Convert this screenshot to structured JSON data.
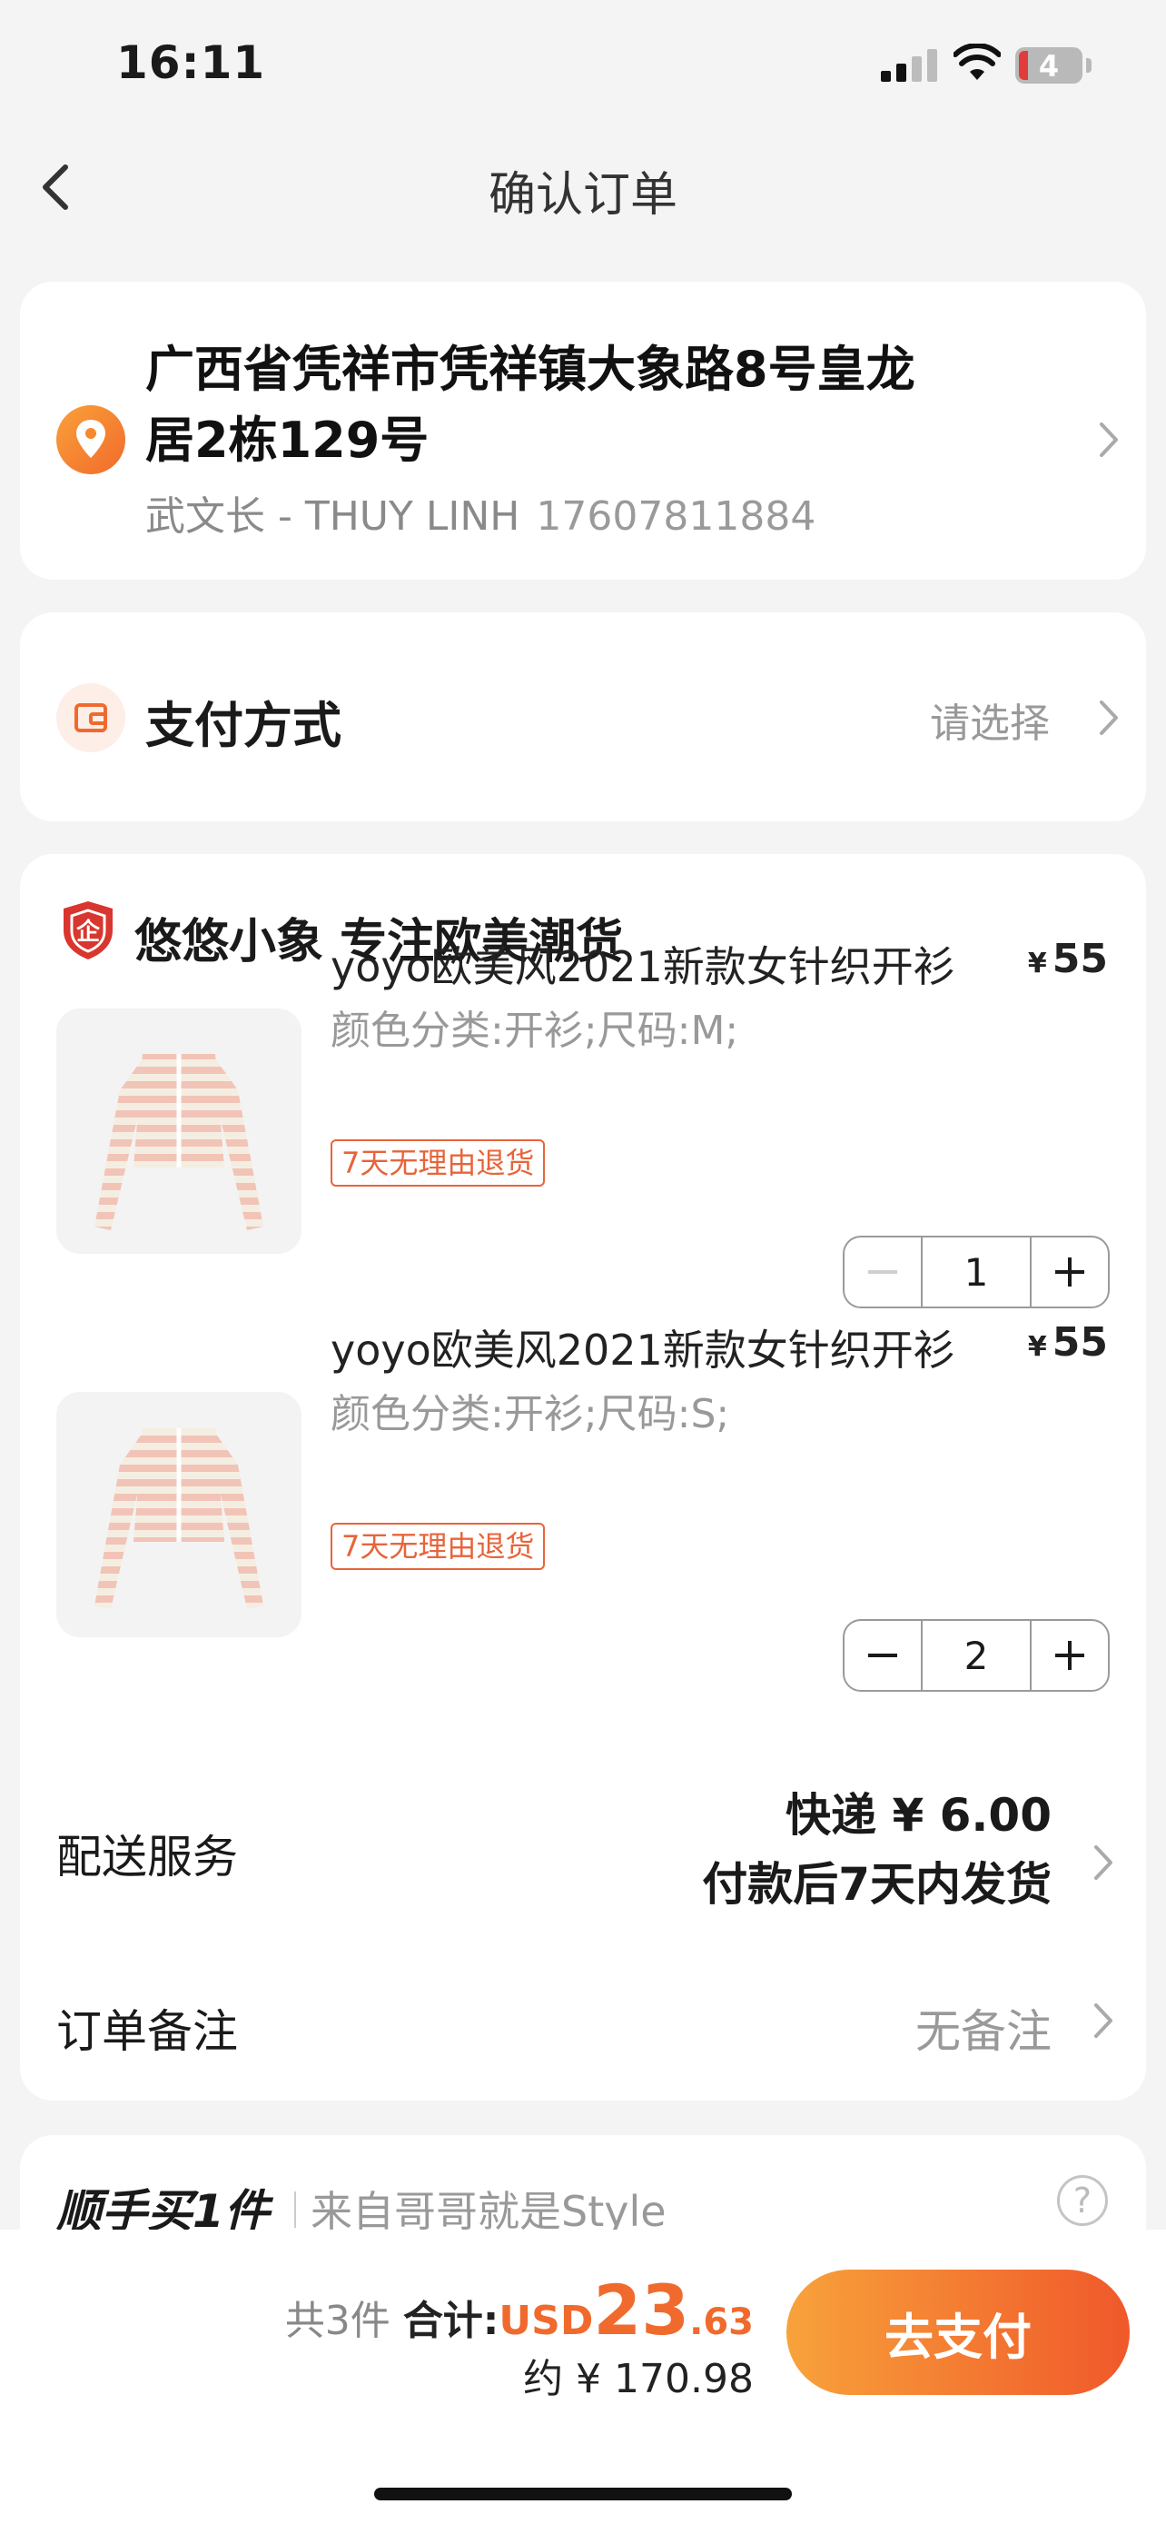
{
  "status": {
    "time": "16:11",
    "battery": "4"
  },
  "nav": {
    "title": "确认订单"
  },
  "address": {
    "line1": "广西省凭祥市凭祥镇大象路8号皇龙",
    "line2": "居2栋129号",
    "name": "武文长 - THUY LINH",
    "phone": "17607811884"
  },
  "payment": {
    "label": "支付方式",
    "placeholder": "请选择"
  },
  "shop": {
    "name": "悠悠小象  专注欧美潮货",
    "items": [
      {
        "title": "yoyo欧美风2021新款女针织开衫",
        "spec": "颜色分类:开衫;尺码:M;",
        "tag": "7天无理由退货",
        "currency": "¥",
        "price": "55",
        "qty": "1"
      },
      {
        "title": "yoyo欧美风2021新款女针织开衫",
        "spec": "颜色分类:开衫;尺码:S;",
        "tag": "7天无理由退货",
        "currency": "¥",
        "price": "55",
        "qty": "2"
      }
    ],
    "delivery": {
      "label": "配送服务",
      "method": "快递 ¥ 6.00",
      "eta": "付款后7天内发货"
    },
    "remark": {
      "label": "订单备注",
      "value": "无备注"
    }
  },
  "addon": {
    "title": "顺手买1件",
    "source": "来自哥哥就是Style",
    "help": "?"
  },
  "summary": {
    "count": "共3件",
    "total_label": "合计:",
    "currency": "USD",
    "amount_int": "23",
    "amount_dec": ".63",
    "approx": "约 ¥ 170.98",
    "pay_button": "去支付"
  },
  "colors": {
    "accent": "#f06a2e",
    "background": "#f4f4f4"
  }
}
